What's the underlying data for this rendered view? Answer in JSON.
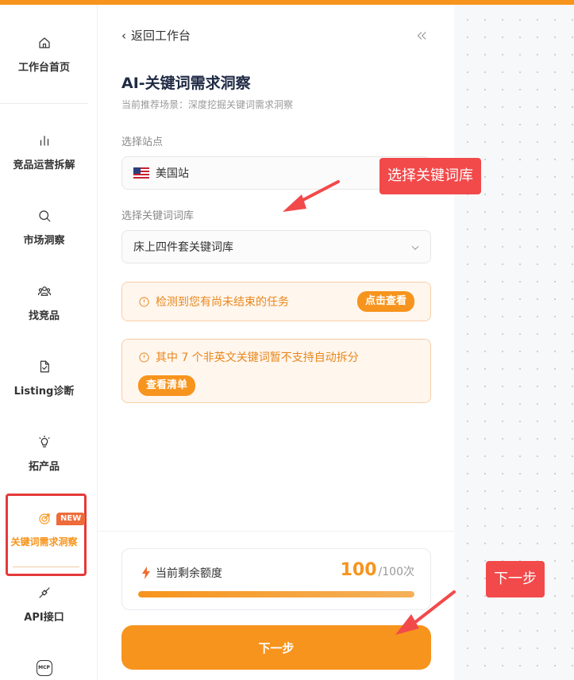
{
  "sidebar": {
    "items": [
      {
        "label": "工作台首页",
        "icon": "home-icon"
      },
      {
        "label": "竞品运营拆解",
        "icon": "bar-chart-icon"
      },
      {
        "label": "市场洞察",
        "icon": "search-icon"
      },
      {
        "label": "找竞品",
        "icon": "users-icon"
      },
      {
        "label": "Listing诊断",
        "icon": "document-check-icon"
      },
      {
        "label": "拓产品",
        "icon": "lightbulb-icon"
      },
      {
        "label": "关键词需求洞察",
        "icon": "target-icon",
        "badge": "NEW",
        "active": true
      },
      {
        "label": "API接口",
        "icon": "plug-icon"
      },
      {
        "label": "",
        "icon": "mcp-icon",
        "icon_text": "MCP"
      }
    ]
  },
  "panel": {
    "back_label": "返回工作台",
    "title": "AI-关键词需求洞察",
    "subtitle": "当前推荐场景：深度挖掘关键词需求洞察",
    "site_label": "选择站点",
    "site_value": "美国站",
    "library_label": "选择关键词词库",
    "library_value": "床上四件套关键词库",
    "notice_unfinished": "检测到您有尚未结束的任务",
    "notice_unfinished_button": "点击查看",
    "notice_nonenglish": "其中 7 个非英文关键词暂不支持自动拆分",
    "notice_nonenglish_button": "查看清单",
    "quota_label": "当前剩余额度",
    "quota_value": "100",
    "quota_total": "/100次",
    "quota_fraction": 1.0,
    "next_button": "下一步"
  },
  "annotations": {
    "callout_library": "选择关键词库",
    "callout_next": "下一步"
  },
  "colors": {
    "accent": "#f7941d",
    "annotation_red": "#f2494a",
    "title": "#1f2a44"
  }
}
